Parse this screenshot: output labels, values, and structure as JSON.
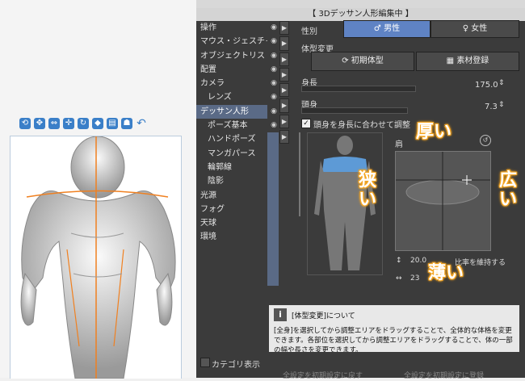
{
  "panel": {
    "title": "【 3Dデッサン人形編集中 】"
  },
  "categories": [
    {
      "label": "操作",
      "sub": false
    },
    {
      "label": "マウス・ジェスチャー",
      "sub": false
    },
    {
      "label": "オブジェクトリスト",
      "sub": false
    },
    {
      "label": "配置",
      "sub": false
    },
    {
      "label": "カメラ",
      "sub": false
    },
    {
      "label": "レンズ",
      "sub": true
    },
    {
      "label": "デッサン人形",
      "sub": false,
      "selected": true
    },
    {
      "label": "ポーズ基本",
      "sub": true
    },
    {
      "label": "ハンドポーズ",
      "sub": true
    },
    {
      "label": "マンガパース",
      "sub": true
    },
    {
      "label": "輪郭線",
      "sub": true
    },
    {
      "label": "陰影",
      "sub": true
    },
    {
      "label": "光源",
      "sub": false
    },
    {
      "label": "フォグ",
      "sub": false
    },
    {
      "label": "天球",
      "sub": false
    },
    {
      "label": "環境",
      "sub": false
    }
  ],
  "category_toggle": "カテゴリ表示",
  "gender": {
    "label": "性別",
    "male": "男性",
    "female": "女性"
  },
  "body_shape": {
    "label": "体型変更",
    "reset": "初期体型",
    "register": "素材登録"
  },
  "height": {
    "label": "身長",
    "value": "175.0"
  },
  "head": {
    "label": "頭身",
    "value": "7.3"
  },
  "head_sync": {
    "label": "頭身を身長に合わせて調整"
  },
  "region": {
    "label": "肩"
  },
  "keep_ratio": {
    "label": "比率を維持する"
  },
  "dims": {
    "w": "20.0",
    "d": "23"
  },
  "annotations": {
    "thick": "厚い",
    "thin": "薄い",
    "narrow": "狭い",
    "wide": "広い"
  },
  "info": {
    "title": "[体型変更]について",
    "body": "[全身]を選択してから調整エリアをドラッグすることで、全体的な体格を変更できます。各部位を選択してから調整エリアをドラッグすることで、体の一部の幅や長さを変更できます。"
  },
  "footer": {
    "reset_all": "全設定を初期設定に戻す",
    "register_all": "全設定を初期設定に登録"
  },
  "colors": {
    "panel_bg": "#3b3b3b",
    "accent": "#5f83c4",
    "selected": "#5a6a86",
    "annotation": "#f5a623",
    "guide": "#f08020"
  }
}
